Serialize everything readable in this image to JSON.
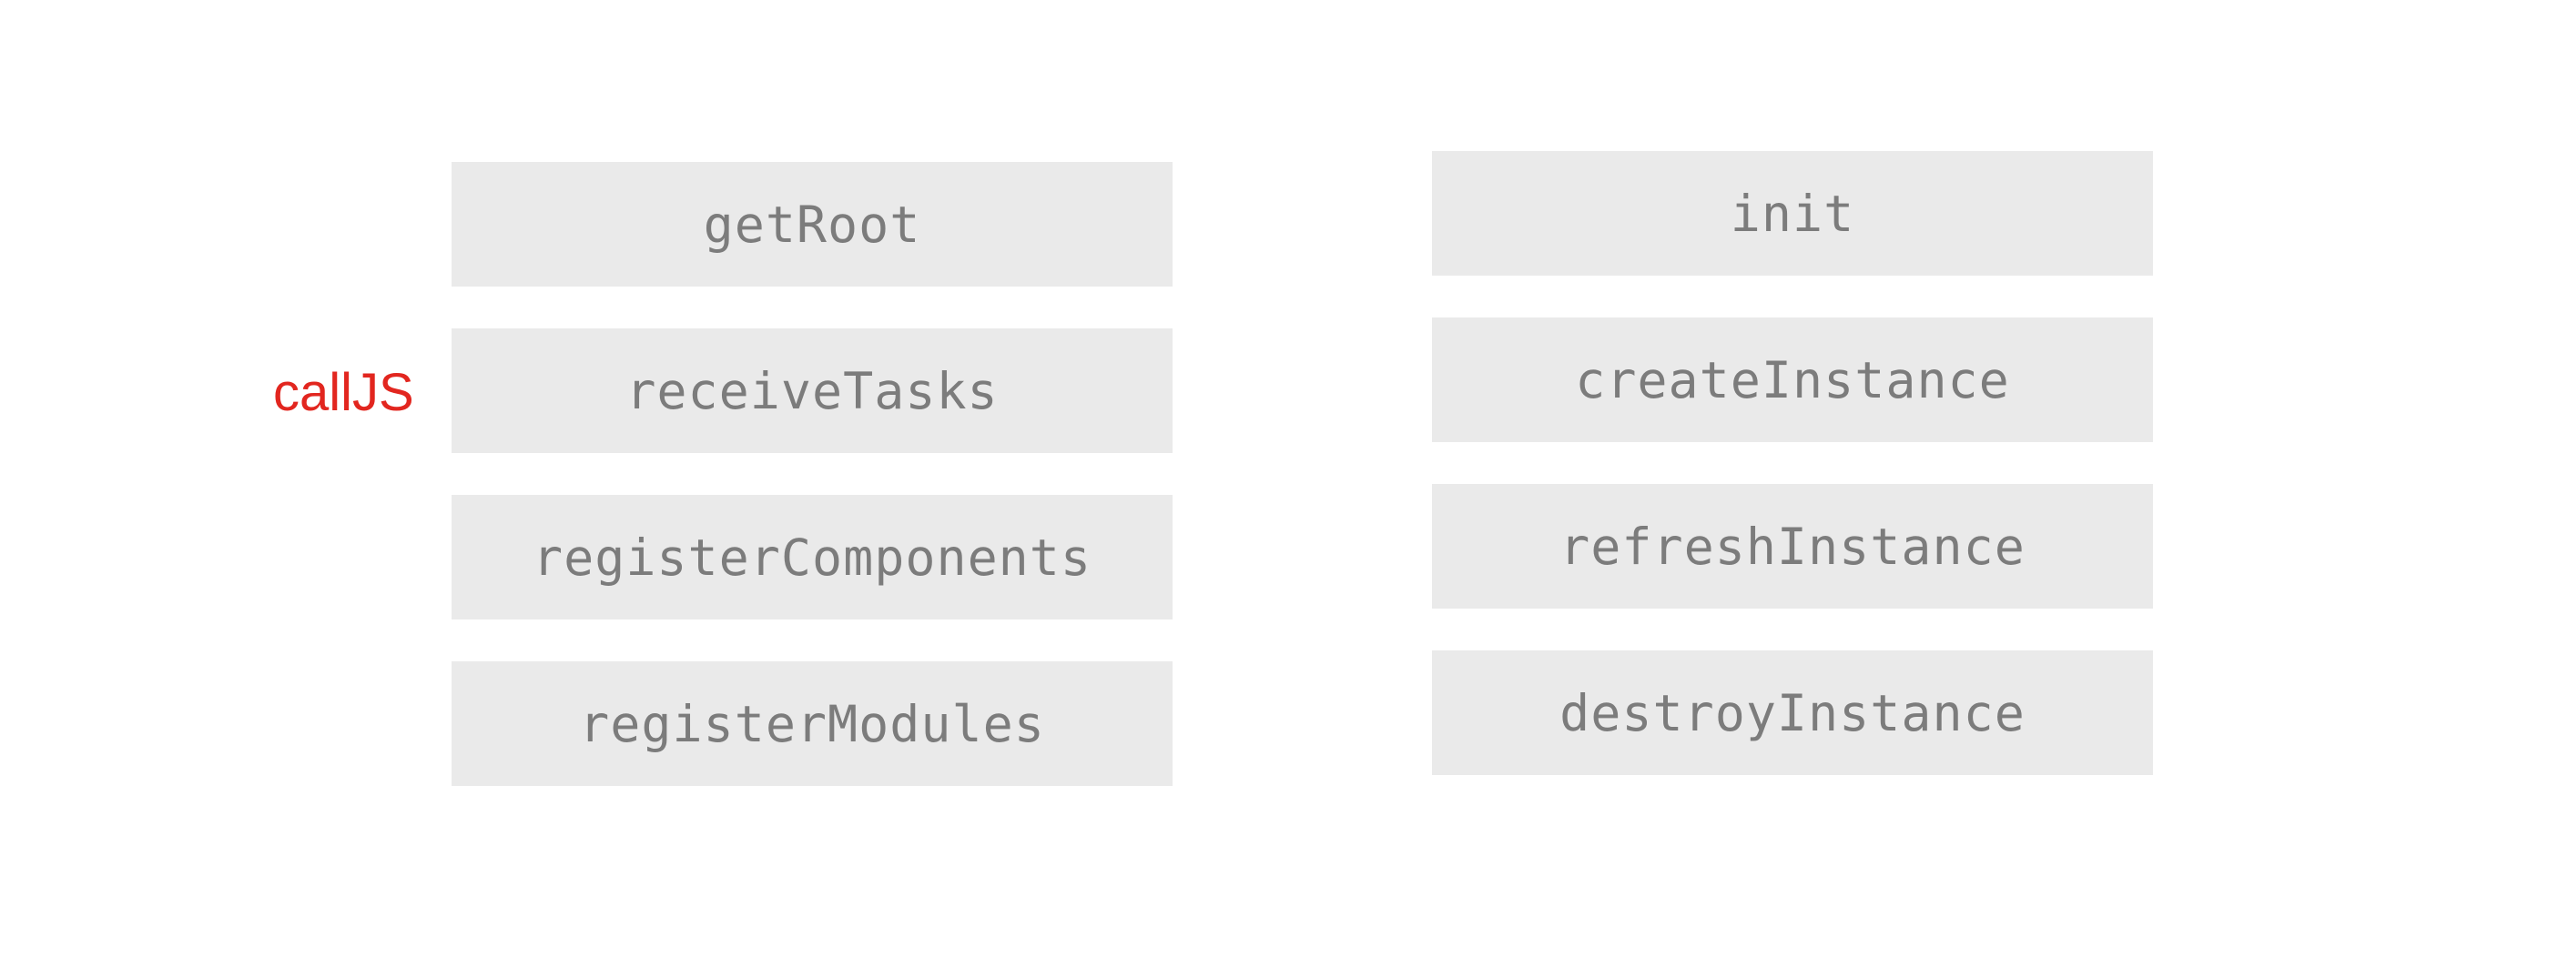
{
  "side_label": "callJS",
  "left_column": [
    "getRoot",
    "receiveTasks",
    "registerComponents",
    "registerModules"
  ],
  "right_column": [
    "init",
    "createInstance",
    "refreshInstance",
    "destroyInstance"
  ],
  "colors": {
    "box_background": "#eaeaea",
    "box_text": "#7c7c7c",
    "side_label": "#e2261f"
  }
}
